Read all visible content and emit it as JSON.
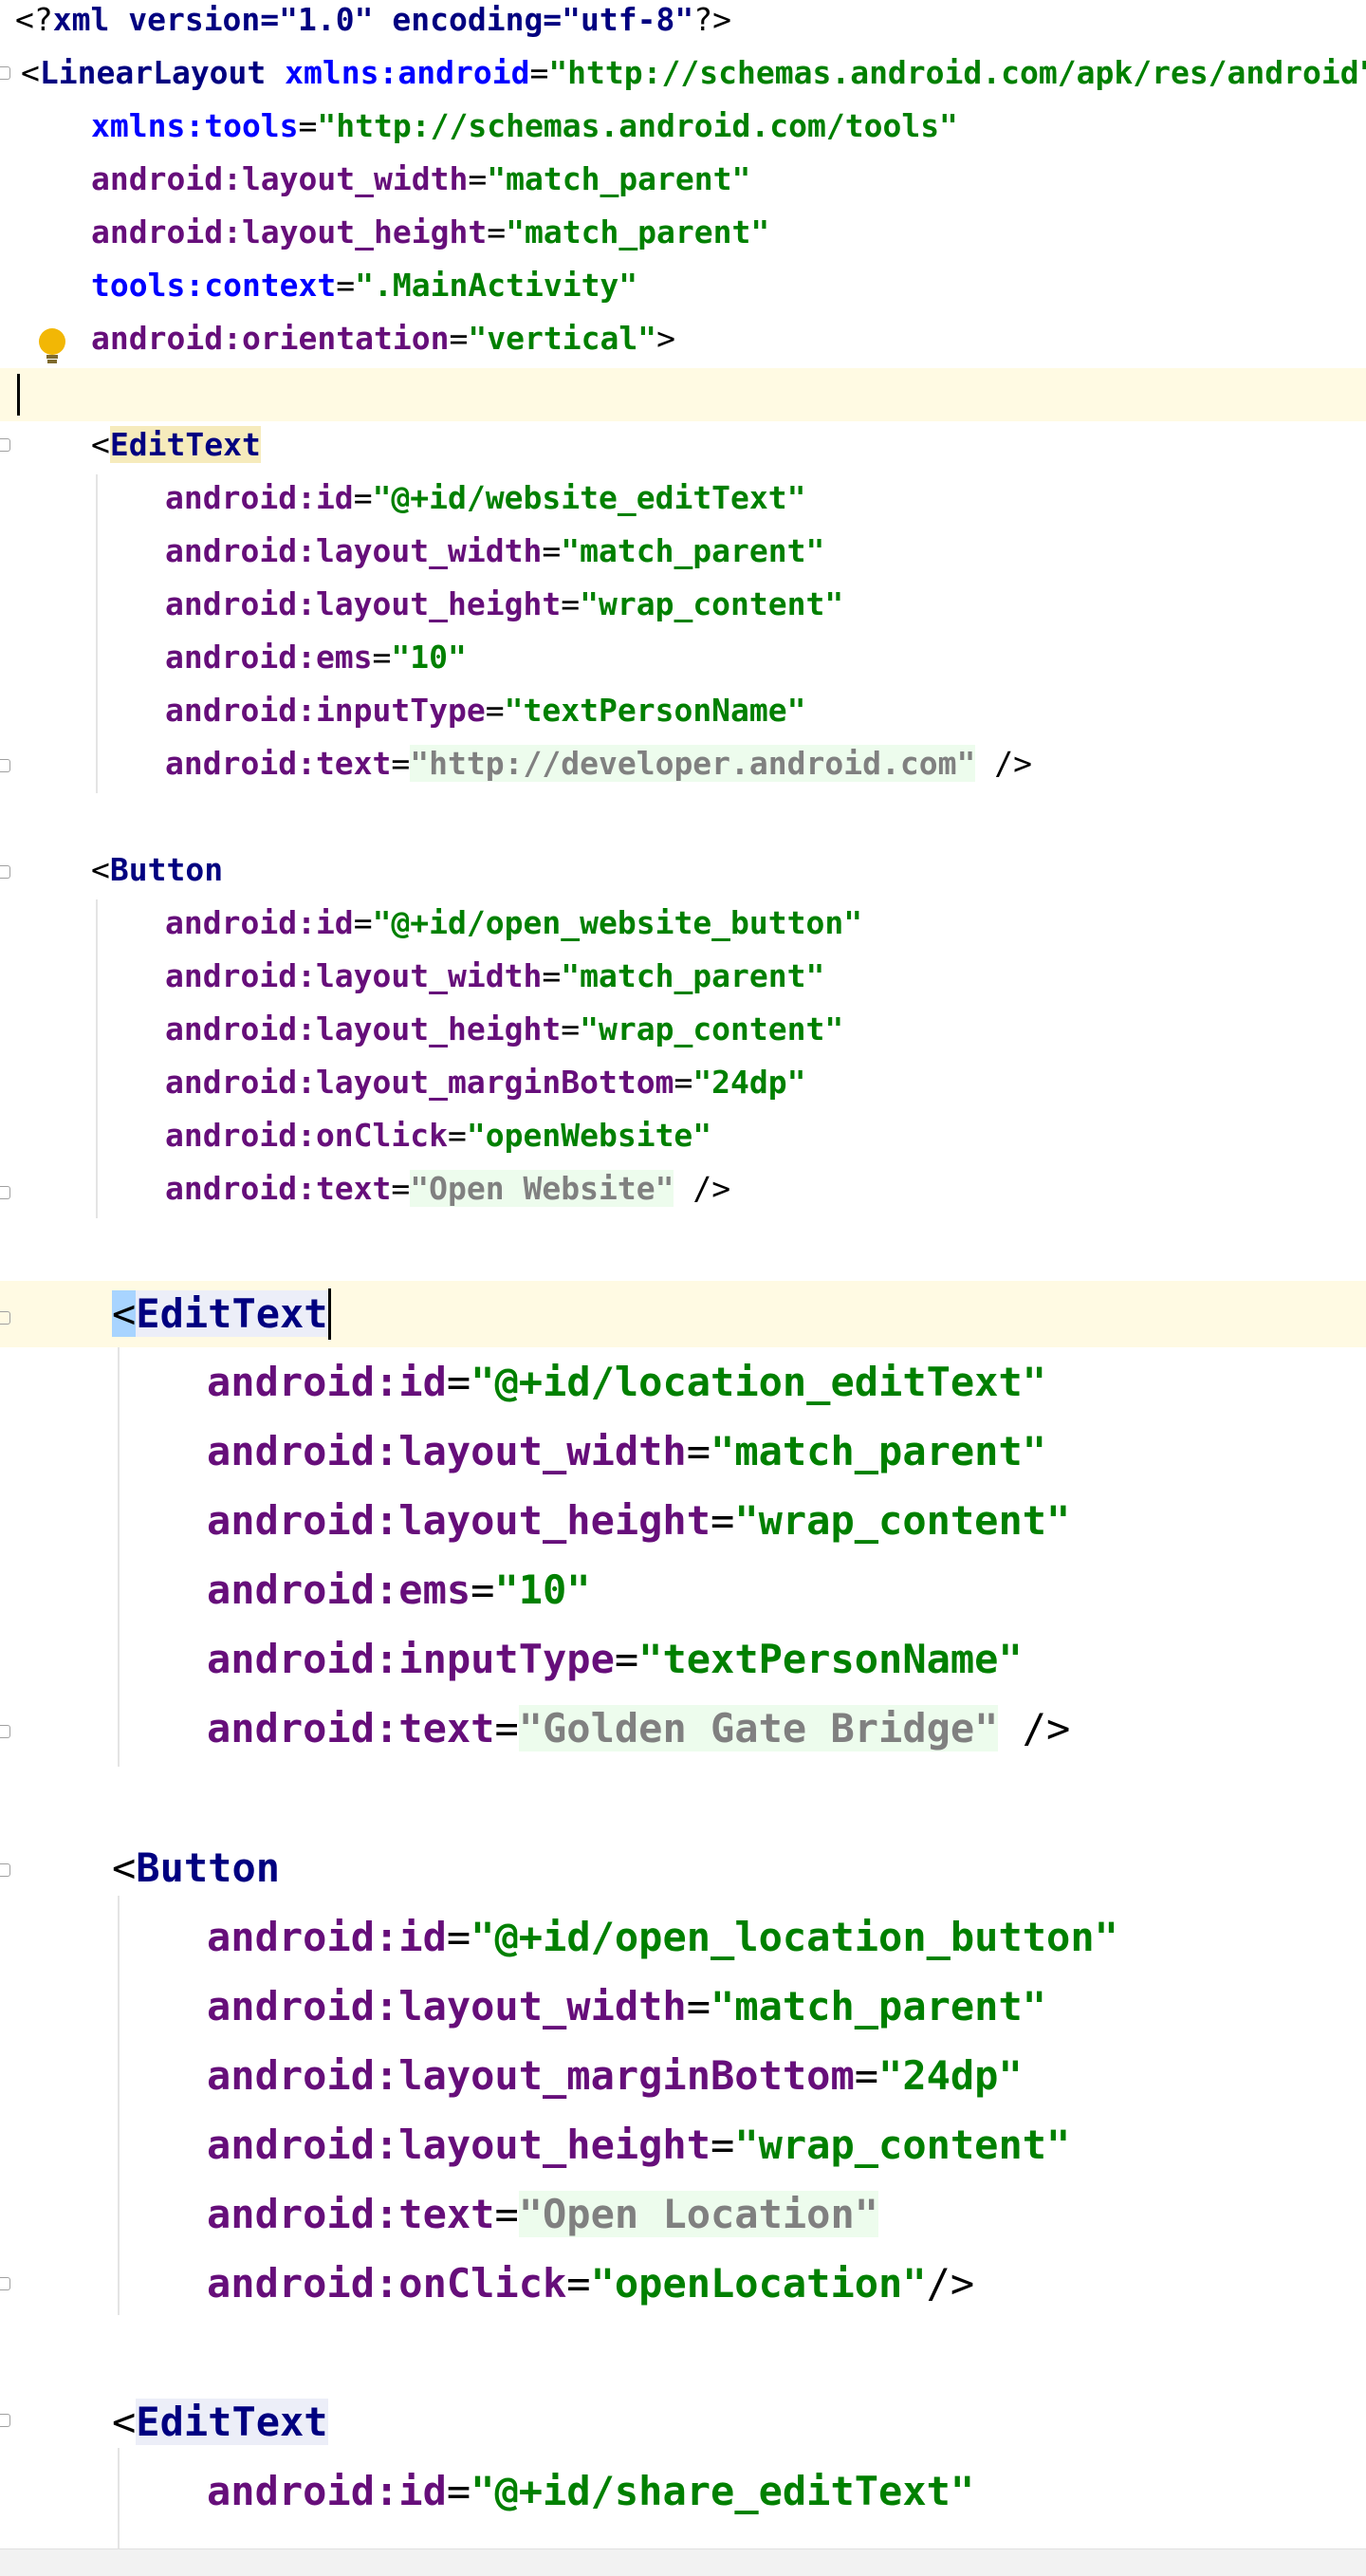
{
  "editor": {
    "lines": [
      {
        "id": "xml-decl",
        "segments": [
          {
            "t": "<?",
            "c": "sym"
          },
          {
            "t": "xml version=\"1.0\" encoding=\"utf-8\"",
            "c": "pi"
          },
          {
            "t": "?>",
            "c": "sym"
          }
        ]
      },
      {
        "id": "linearlayout-open",
        "segments": [
          {
            "t": "<",
            "c": "sym"
          },
          {
            "t": "LinearLayout ",
            "c": "tag"
          },
          {
            "t": "xmlns:android",
            "c": "ns"
          },
          {
            "t": "=",
            "c": "sym"
          },
          {
            "t": "\"http://schemas.android.com/apk/res/android\"",
            "c": "val"
          }
        ]
      },
      {
        "id": "xmlns-tools",
        "segments": [
          {
            "t": "xmlns:tools",
            "c": "ns"
          },
          {
            "t": "=",
            "c": "sym"
          },
          {
            "t": "\"http://schemas.android.com/tools\"",
            "c": "val"
          }
        ]
      },
      {
        "id": "ll-layout-width",
        "segments": [
          {
            "t": "android:layout_width",
            "c": "attr"
          },
          {
            "t": "=",
            "c": "sym"
          },
          {
            "t": "\"match_parent\"",
            "c": "val"
          }
        ]
      },
      {
        "id": "ll-layout-height",
        "segments": [
          {
            "t": "android:layout_height",
            "c": "attr"
          },
          {
            "t": "=",
            "c": "sym"
          },
          {
            "t": "\"match_parent\"",
            "c": "val"
          }
        ]
      },
      {
        "id": "ll-tools-context",
        "segments": [
          {
            "t": "tools:context",
            "c": "attr-tools"
          },
          {
            "t": "=",
            "c": "sym"
          },
          {
            "t": "\".MainActivity\"",
            "c": "val"
          }
        ]
      },
      {
        "id": "ll-orientation",
        "segments": [
          {
            "t": "android:orientation",
            "c": "attr"
          },
          {
            "t": "=",
            "c": "sym"
          },
          {
            "t": "\"vertical\"",
            "c": "val"
          },
          {
            "t": ">",
            "c": "sym"
          }
        ]
      },
      {
        "id": "blank-1",
        "segments": []
      },
      {
        "id": "edittext1-open",
        "segments": [
          {
            "t": "<",
            "c": "sym"
          },
          {
            "t": "EditText",
            "c": "tag-hl-yellow"
          }
        ]
      },
      {
        "id": "edittext1-id",
        "segments": [
          {
            "t": "android:id",
            "c": "attr"
          },
          {
            "t": "=",
            "c": "sym"
          },
          {
            "t": "\"@+id/website_editText\"",
            "c": "val"
          }
        ]
      },
      {
        "id": "edittext1-width",
        "segments": [
          {
            "t": "android:layout_width",
            "c": "attr"
          },
          {
            "t": "=",
            "c": "sym"
          },
          {
            "t": "\"match_parent\"",
            "c": "val"
          }
        ]
      },
      {
        "id": "edittext1-height",
        "segments": [
          {
            "t": "android:layout_height",
            "c": "attr"
          },
          {
            "t": "=",
            "c": "sym"
          },
          {
            "t": "\"wrap_content\"",
            "c": "val"
          }
        ]
      },
      {
        "id": "edittext1-ems",
        "segments": [
          {
            "t": "android:ems",
            "c": "attr"
          },
          {
            "t": "=",
            "c": "sym"
          },
          {
            "t": "\"10\"",
            "c": "val"
          }
        ]
      },
      {
        "id": "edittext1-inputtype",
        "segments": [
          {
            "t": "android:inputType",
            "c": "attr"
          },
          {
            "t": "=",
            "c": "sym"
          },
          {
            "t": "\"textPersonName\"",
            "c": "val"
          }
        ]
      },
      {
        "id": "edittext1-text",
        "segments": [
          {
            "t": "android:text",
            "c": "attr"
          },
          {
            "t": "=",
            "c": "sym"
          },
          {
            "t": "\"http://developer.android.com\"",
            "c": "res"
          },
          {
            "t": " />",
            "c": "sym"
          }
        ]
      },
      {
        "id": "blank-2",
        "segments": []
      },
      {
        "id": "button1-open",
        "segments": [
          {
            "t": "<",
            "c": "sym"
          },
          {
            "t": "Button",
            "c": "tag"
          }
        ]
      },
      {
        "id": "button1-id",
        "segments": [
          {
            "t": "android:id",
            "c": "attr"
          },
          {
            "t": "=",
            "c": "sym"
          },
          {
            "t": "\"@+id/open_website_button\"",
            "c": "val"
          }
        ]
      },
      {
        "id": "button1-width",
        "segments": [
          {
            "t": "android:layout_width",
            "c": "attr"
          },
          {
            "t": "=",
            "c": "sym"
          },
          {
            "t": "\"match_parent\"",
            "c": "val"
          }
        ]
      },
      {
        "id": "button1-height",
        "segments": [
          {
            "t": "android:layout_height",
            "c": "attr"
          },
          {
            "t": "=",
            "c": "sym"
          },
          {
            "t": "\"wrap_content\"",
            "c": "val"
          }
        ]
      },
      {
        "id": "button1-marginbottom",
        "segments": [
          {
            "t": "android:layout_marginBottom",
            "c": "attr"
          },
          {
            "t": "=",
            "c": "sym"
          },
          {
            "t": "\"24dp\"",
            "c": "val"
          }
        ]
      },
      {
        "id": "button1-onclick",
        "segments": [
          {
            "t": "android:onClick",
            "c": "attr"
          },
          {
            "t": "=",
            "c": "sym"
          },
          {
            "t": "\"openWebsite\"",
            "c": "val"
          }
        ]
      },
      {
        "id": "button1-text",
        "segments": [
          {
            "t": "android:text",
            "c": "attr"
          },
          {
            "t": "=",
            "c": "sym"
          },
          {
            "t": "\"Open Website\"",
            "c": "res"
          },
          {
            "t": " />",
            "c": "sym"
          }
        ]
      },
      {
        "id": "blank-3",
        "segments": []
      },
      {
        "id": "edittext2-open",
        "segments": [
          {
            "t": "<",
            "c": "sym brace-hl"
          },
          {
            "t": "EditText",
            "c": "tag tag-hl"
          }
        ]
      },
      {
        "id": "edittext2-id",
        "segments": [
          {
            "t": "android:id",
            "c": "attr"
          },
          {
            "t": "=",
            "c": "sym"
          },
          {
            "t": "\"@+id/location_editText\"",
            "c": "val"
          }
        ]
      },
      {
        "id": "edittext2-width",
        "segments": [
          {
            "t": "android:layout_width",
            "c": "attr"
          },
          {
            "t": "=",
            "c": "sym"
          },
          {
            "t": "\"match_parent\"",
            "c": "val"
          }
        ]
      },
      {
        "id": "edittext2-height",
        "segments": [
          {
            "t": "android:layout_height",
            "c": "attr"
          },
          {
            "t": "=",
            "c": "sym"
          },
          {
            "t": "\"wrap_content\"",
            "c": "val"
          }
        ]
      },
      {
        "id": "edittext2-ems",
        "segments": [
          {
            "t": "android:ems",
            "c": "attr"
          },
          {
            "t": "=",
            "c": "sym"
          },
          {
            "t": "\"10\"",
            "c": "val"
          }
        ]
      },
      {
        "id": "edittext2-inputtype",
        "segments": [
          {
            "t": "android:inputType",
            "c": "attr"
          },
          {
            "t": "=",
            "c": "sym"
          },
          {
            "t": "\"textPersonName\"",
            "c": "val"
          }
        ]
      },
      {
        "id": "edittext2-text",
        "segments": [
          {
            "t": "android:text",
            "c": "attr"
          },
          {
            "t": "=",
            "c": "sym"
          },
          {
            "t": "\"Golden Gate Bridge\"",
            "c": "res"
          },
          {
            "t": " />",
            "c": "sym"
          }
        ]
      },
      {
        "id": "blank-4",
        "segments": []
      },
      {
        "id": "button2-open",
        "segments": [
          {
            "t": "<",
            "c": "sym"
          },
          {
            "t": "Button",
            "c": "tag"
          }
        ]
      },
      {
        "id": "button2-id",
        "segments": [
          {
            "t": "android:id",
            "c": "attr"
          },
          {
            "t": "=",
            "c": "sym"
          },
          {
            "t": "\"@+id/open_location_button\"",
            "c": "val"
          }
        ]
      },
      {
        "id": "button2-width",
        "segments": [
          {
            "t": "android:layout_width",
            "c": "attr"
          },
          {
            "t": "=",
            "c": "sym"
          },
          {
            "t": "\"match_parent\"",
            "c": "val"
          }
        ]
      },
      {
        "id": "button2-marginbottom",
        "segments": [
          {
            "t": "android:layout_marginBottom",
            "c": "attr"
          },
          {
            "t": "=",
            "c": "sym"
          },
          {
            "t": "\"24dp\"",
            "c": "val"
          }
        ]
      },
      {
        "id": "button2-height",
        "segments": [
          {
            "t": "android:layout_height",
            "c": "attr"
          },
          {
            "t": "=",
            "c": "sym"
          },
          {
            "t": "\"wrap_content\"",
            "c": "val"
          }
        ]
      },
      {
        "id": "button2-text",
        "segments": [
          {
            "t": "android:text",
            "c": "attr"
          },
          {
            "t": "=",
            "c": "sym"
          },
          {
            "t": "\"Open Location\"",
            "c": "res"
          }
        ]
      },
      {
        "id": "button2-onclick",
        "segments": [
          {
            "t": "android:onClick",
            "c": "attr"
          },
          {
            "t": "=",
            "c": "sym"
          },
          {
            "t": "\"openLocation\"",
            "c": "val"
          },
          {
            "t": "/>",
            "c": "sym"
          }
        ]
      },
      {
        "id": "blank-5",
        "segments": []
      },
      {
        "id": "edittext3-open",
        "segments": [
          {
            "t": "<",
            "c": "sym"
          },
          {
            "t": "EditText",
            "c": "tag tag-hl"
          }
        ]
      },
      {
        "id": "edittext3-id",
        "segments": [
          {
            "t": "android:id",
            "c": "attr"
          },
          {
            "t": "=",
            "c": "sym"
          },
          {
            "t": "\"@+id/share_editText\"",
            "c": "val"
          }
        ]
      }
    ]
  }
}
